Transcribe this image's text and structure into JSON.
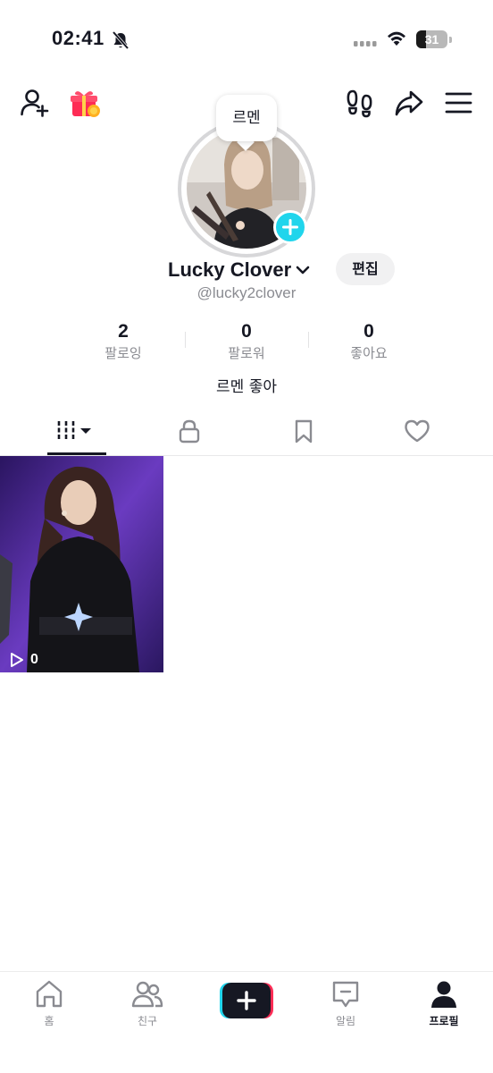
{
  "status_bar": {
    "time": "02:41",
    "battery_level": "31",
    "battery_fraction": 0.31
  },
  "profile": {
    "note": "르멘",
    "display_name": "Lucky Clover",
    "username": "@lucky2clover",
    "edit_label": "편집",
    "bio": "르멘 좋아"
  },
  "stats": [
    {
      "value": "2",
      "label": "팔로잉"
    },
    {
      "value": "0",
      "label": "팔로워"
    },
    {
      "value": "0",
      "label": "좋아요"
    }
  ],
  "tabs": [
    {
      "icon": "grid-videos-icon",
      "active": true
    },
    {
      "icon": "lock-icon",
      "active": false
    },
    {
      "icon": "bookmark-icon",
      "active": false
    },
    {
      "icon": "heart-icon",
      "active": false
    }
  ],
  "videos": [
    {
      "views": "0"
    }
  ],
  "bottom_nav": [
    {
      "label": "홈",
      "icon": "home-icon"
    },
    {
      "label": "친구",
      "icon": "friends-icon"
    },
    {
      "label": "",
      "icon": "create-plus-icon"
    },
    {
      "label": "알림",
      "icon": "inbox-icon"
    },
    {
      "label": "프로필",
      "icon": "profile-icon",
      "active": true
    }
  ],
  "colors": {
    "accent_cyan": "#20d5ec",
    "accent_red": "#fe2c55",
    "text_primary": "#161823",
    "text_secondary": "#8a8b91"
  }
}
